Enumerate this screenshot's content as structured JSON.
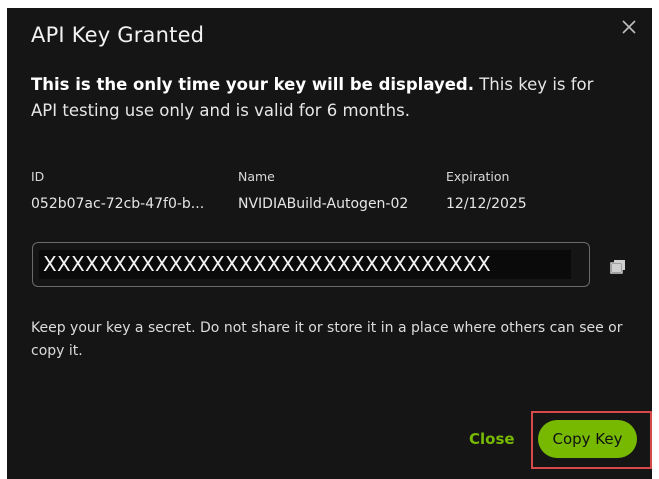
{
  "dialog": {
    "title": "API Key Granted",
    "notice_bold": "This is the only time your key will be displayed.",
    "notice_rest": " This key is for API testing use only and is valid for 6 months.",
    "meta": {
      "id_label": "ID",
      "id_value": "052b07ac-72cb-47f0-b...",
      "name_label": "Name",
      "name_value": "NVIDIABuild-Autogen-02",
      "expiration_label": "Expiration",
      "expiration_value": "12/12/2025"
    },
    "key_value": "XXXXXXXXXXXXXXXXXXXXXXXXXXXXXXXX",
    "hint": "Keep your key a secret. Do not share it or store it in a place where others can see or copy it.",
    "close_label": "Close",
    "copy_label": "Copy Key"
  },
  "icons": {
    "close": "close-icon",
    "copy": "copy-icon"
  },
  "colors": {
    "background": "#151515",
    "accent": "#76b900",
    "highlight": "#d84a4a"
  }
}
